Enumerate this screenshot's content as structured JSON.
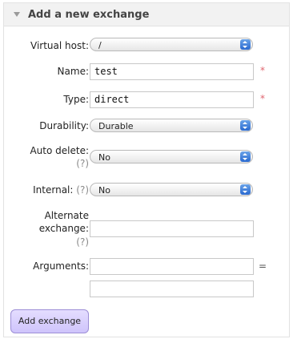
{
  "header": {
    "title": "Add a new exchange"
  },
  "form": {
    "virtual_host": {
      "label": "Virtual host:",
      "value": "/"
    },
    "name": {
      "label": "Name:",
      "value": "test",
      "required_mark": "*"
    },
    "type": {
      "label": "Type:",
      "value": "direct",
      "required_mark": "*"
    },
    "durability": {
      "label": "Durability:",
      "value": "Durable"
    },
    "auto_delete": {
      "label": "Auto delete:",
      "help": "(?)",
      "value": "No"
    },
    "internal": {
      "label": "Internal:",
      "help": "(?)",
      "value": "No"
    },
    "alternate_exchange": {
      "label_line1": "Alternate",
      "label_line2": "exchange:",
      "help": "(?)",
      "value": ""
    },
    "arguments": {
      "label": "Arguments:",
      "equals": "=",
      "key_value": "",
      "value_value": ""
    },
    "submit_label": "Add exchange"
  },
  "colors": {
    "submit_bg": "#cfc4fb",
    "required": "#e0656f",
    "select_arrow": "#2a6ad0"
  }
}
